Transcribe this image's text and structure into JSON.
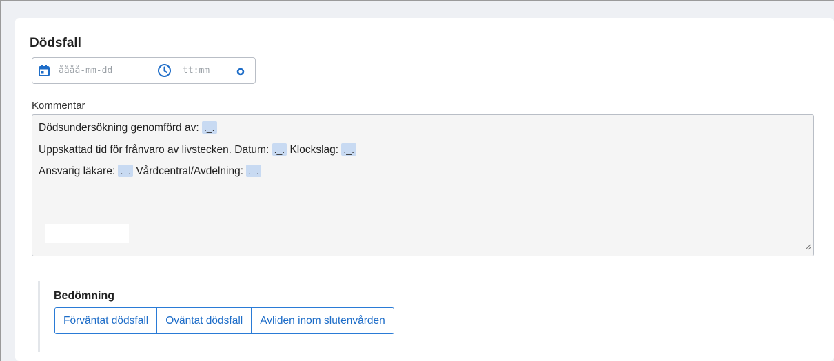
{
  "section": {
    "title": "Dödsfall"
  },
  "datetime": {
    "date_placeholder": "åååå-mm-dd",
    "time_placeholder": "tt:mm",
    "date_icon": "calendar-icon",
    "time_icon": "clock-icon",
    "extra_icon": "circle-dot-icon"
  },
  "comment": {
    "label": "Kommentar",
    "lines": [
      {
        "segments": [
          {
            "text": "Dödsundersökning genomförd av: "
          },
          {
            "placeholder": "._."
          }
        ]
      },
      {
        "segments": [
          {
            "text": "Uppskattad tid för frånvaro av livstecken. Datum: "
          },
          {
            "placeholder": "._."
          },
          {
            "text": " Klockslag:  "
          },
          {
            "placeholder": "._."
          }
        ]
      },
      {
        "segments": [
          {
            "text": "Ansvarig läkare: "
          },
          {
            "placeholder": "._."
          },
          {
            "text": "   Vårdcentral/Avdelning: "
          },
          {
            "placeholder": "._."
          }
        ]
      }
    ]
  },
  "assessment": {
    "label": "Bedömning",
    "options": [
      "Förväntat dödsfall",
      "Oväntat dödsfall",
      "Avliden inom slutenvården"
    ]
  },
  "colors": {
    "accent": "#1e6dc8",
    "placeholder_highlight": "#c8daf2",
    "textarea_bg": "#f5f5f5"
  }
}
